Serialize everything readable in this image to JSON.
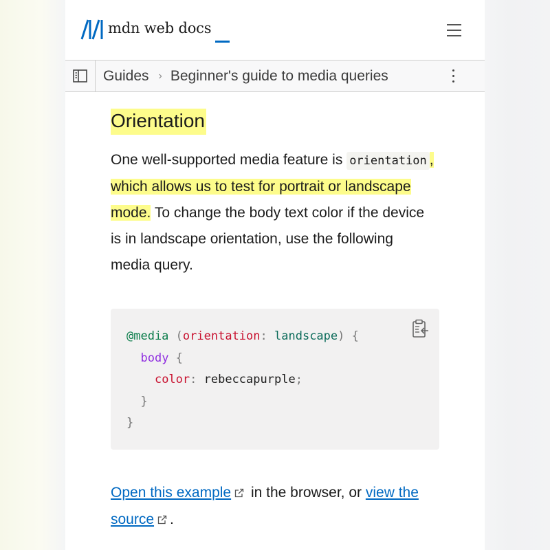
{
  "header": {
    "logo_text": "mdn web docs",
    "menu_icon": "hamburger-menu-icon"
  },
  "breadcrumb": {
    "sidebar_icon": "sidebar-toggle-icon",
    "items": [
      "Guides",
      "Beginner's guide to media queries"
    ],
    "separator": "›",
    "more_icon": "kebab-menu-icon"
  },
  "article": {
    "heading": "Orientation",
    "paragraph": {
      "part1": "One well-supported media feature is ",
      "code": "orientation",
      "part2_highlight_a": ", which ",
      "part2_highlight_b": "allows us to test for portrait or landscape mode.",
      "part3": " To change the body text color if the device is in landscape orientation, use the following media query."
    },
    "code_block": {
      "lines": [
        [
          "@media",
          " ",
          "(",
          "orientation",
          ":",
          " ",
          "landscape",
          ")",
          " {"
        ],
        [
          "  ",
          "body",
          " {"
        ],
        [
          "    ",
          "color",
          ":",
          " rebeccapurple",
          ";"
        ],
        [
          "  ",
          "}"
        ],
        [
          "}"
        ]
      ],
      "copy_icon": "clipboard-copy-icon"
    },
    "footer": {
      "link1": "Open this example",
      "middle": " in the browser, or ",
      "link2": "view the source",
      "end": "."
    }
  },
  "colors": {
    "highlight": "#fdfc8b",
    "link": "#0069c2",
    "code_bg": "#f2f1f1"
  }
}
